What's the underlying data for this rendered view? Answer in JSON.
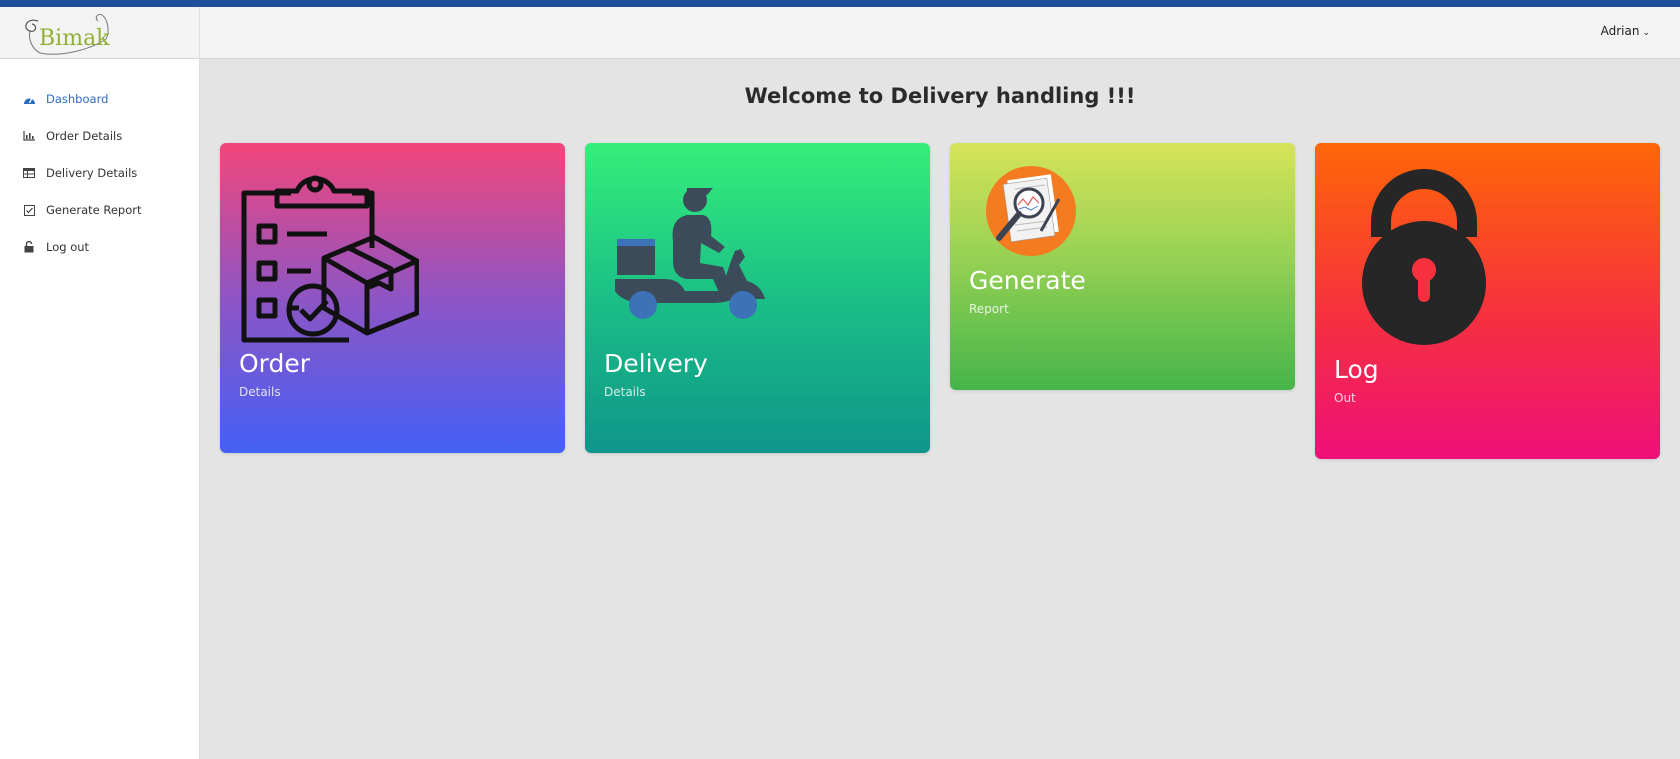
{
  "header": {
    "logo_text": "Bimak",
    "user_name": "Adrian",
    "user_chevron": "⌄"
  },
  "sidebar": {
    "items": [
      {
        "label": "Dashboard",
        "icon": "dashboard-icon",
        "active": true
      },
      {
        "label": "Order Details",
        "icon": "bar-chart-icon",
        "active": false
      },
      {
        "label": "Delivery Details",
        "icon": "table-icon",
        "active": false
      },
      {
        "label": "Generate Report",
        "icon": "checkbox-icon",
        "active": false
      },
      {
        "label": "Log out",
        "icon": "unlock-icon",
        "active": false
      }
    ]
  },
  "main": {
    "welcome": "Welcome to Delivery handling !!!",
    "cards": [
      {
        "title": "Order",
        "subtitle": "Details",
        "icon": "order-clipboard-icon"
      },
      {
        "title": "Delivery",
        "subtitle": "Details",
        "icon": "delivery-scooter-icon"
      },
      {
        "title": "Generate",
        "subtitle": "Report",
        "icon": "report-magnifier-icon"
      },
      {
        "title": "Log",
        "subtitle": "Out",
        "icon": "padlock-icon"
      }
    ]
  },
  "colors": {
    "top_strip": "#1f4f99",
    "active_nav": "#2e6bbf",
    "logo_green": "#8fb236"
  }
}
